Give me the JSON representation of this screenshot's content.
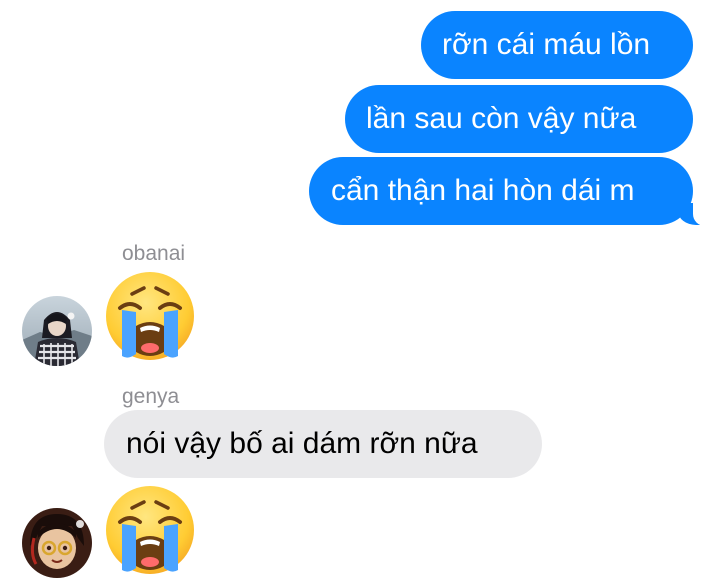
{
  "colors": {
    "accent": "#0a84ff",
    "incoming": "#e9e9eb",
    "secondary": "#8e8e93"
  },
  "messages": {
    "outgoing": [
      {
        "text": "rỡn cái máu lồn"
      },
      {
        "text": "lần sau còn vậy nữa"
      },
      {
        "text": "cẩn thận hai hòn dái m"
      }
    ],
    "obanai": {
      "sender": "obanai",
      "avatar_icon": "avatar-icon",
      "content_icon": "loudly-crying-face-icon"
    },
    "genya": {
      "sender": "genya",
      "text": "nói vậy bố ai dám rỡn nữa",
      "avatar_icon": "avatar-icon",
      "content_icon": "loudly-crying-face-icon"
    }
  }
}
